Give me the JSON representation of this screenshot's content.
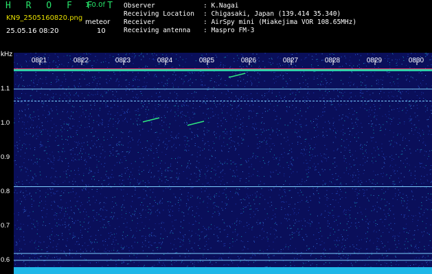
{
  "header": {
    "title": "H R O F F T",
    "version": "1.0.0f",
    "filename": "KN9_2505160820.png",
    "datetime": "25.05.16 08:20",
    "meteor_label": "meteor",
    "meteor_count": "10",
    "observer_label": "Observer",
    "observer_value": ": K.Nagai",
    "location_label": "Receiving Location",
    "location_value": ": Chigasaki, Japan (139.414 35.340)",
    "receiver_label": "Receiver",
    "receiver_value": ": AirSpy mini (Miakejima VOR 108.65MHz)",
    "antenna_label": "Receiving antenna",
    "antenna_value": ": Maspro FM-3"
  },
  "colors": {
    "background": "#000000",
    "plot_bg": "#0a0f5a",
    "title": "#27e36a",
    "filename": "#e8e000",
    "signal_line": "#7fd0ff",
    "band_top": "#ff4a6a"
  },
  "chart_data": {
    "type": "heatmap",
    "x_unit": "time (HHMM)",
    "y_unit": "kHz",
    "x_ticks": [
      "0821",
      "0822",
      "0823",
      "0824",
      "0825",
      "0826",
      "0827",
      "0828",
      "0829",
      "0830"
    ],
    "y_ticks": [
      "1.1",
      "1.0",
      "0.9",
      "0.8",
      "0.7",
      "0.6"
    ],
    "ylabel": "kHz",
    "ylim": [
      0.6,
      1.15
    ],
    "horizontal_lines_khz": [
      1.1,
      1.065,
      0.815,
      0.62,
      0.6
    ],
    "meteor_echoes": [
      {
        "time": "0823",
        "khz": 1.01
      },
      {
        "time": "0824",
        "khz": 1.0
      },
      {
        "time": "0826",
        "khz": 1.14
      }
    ]
  }
}
